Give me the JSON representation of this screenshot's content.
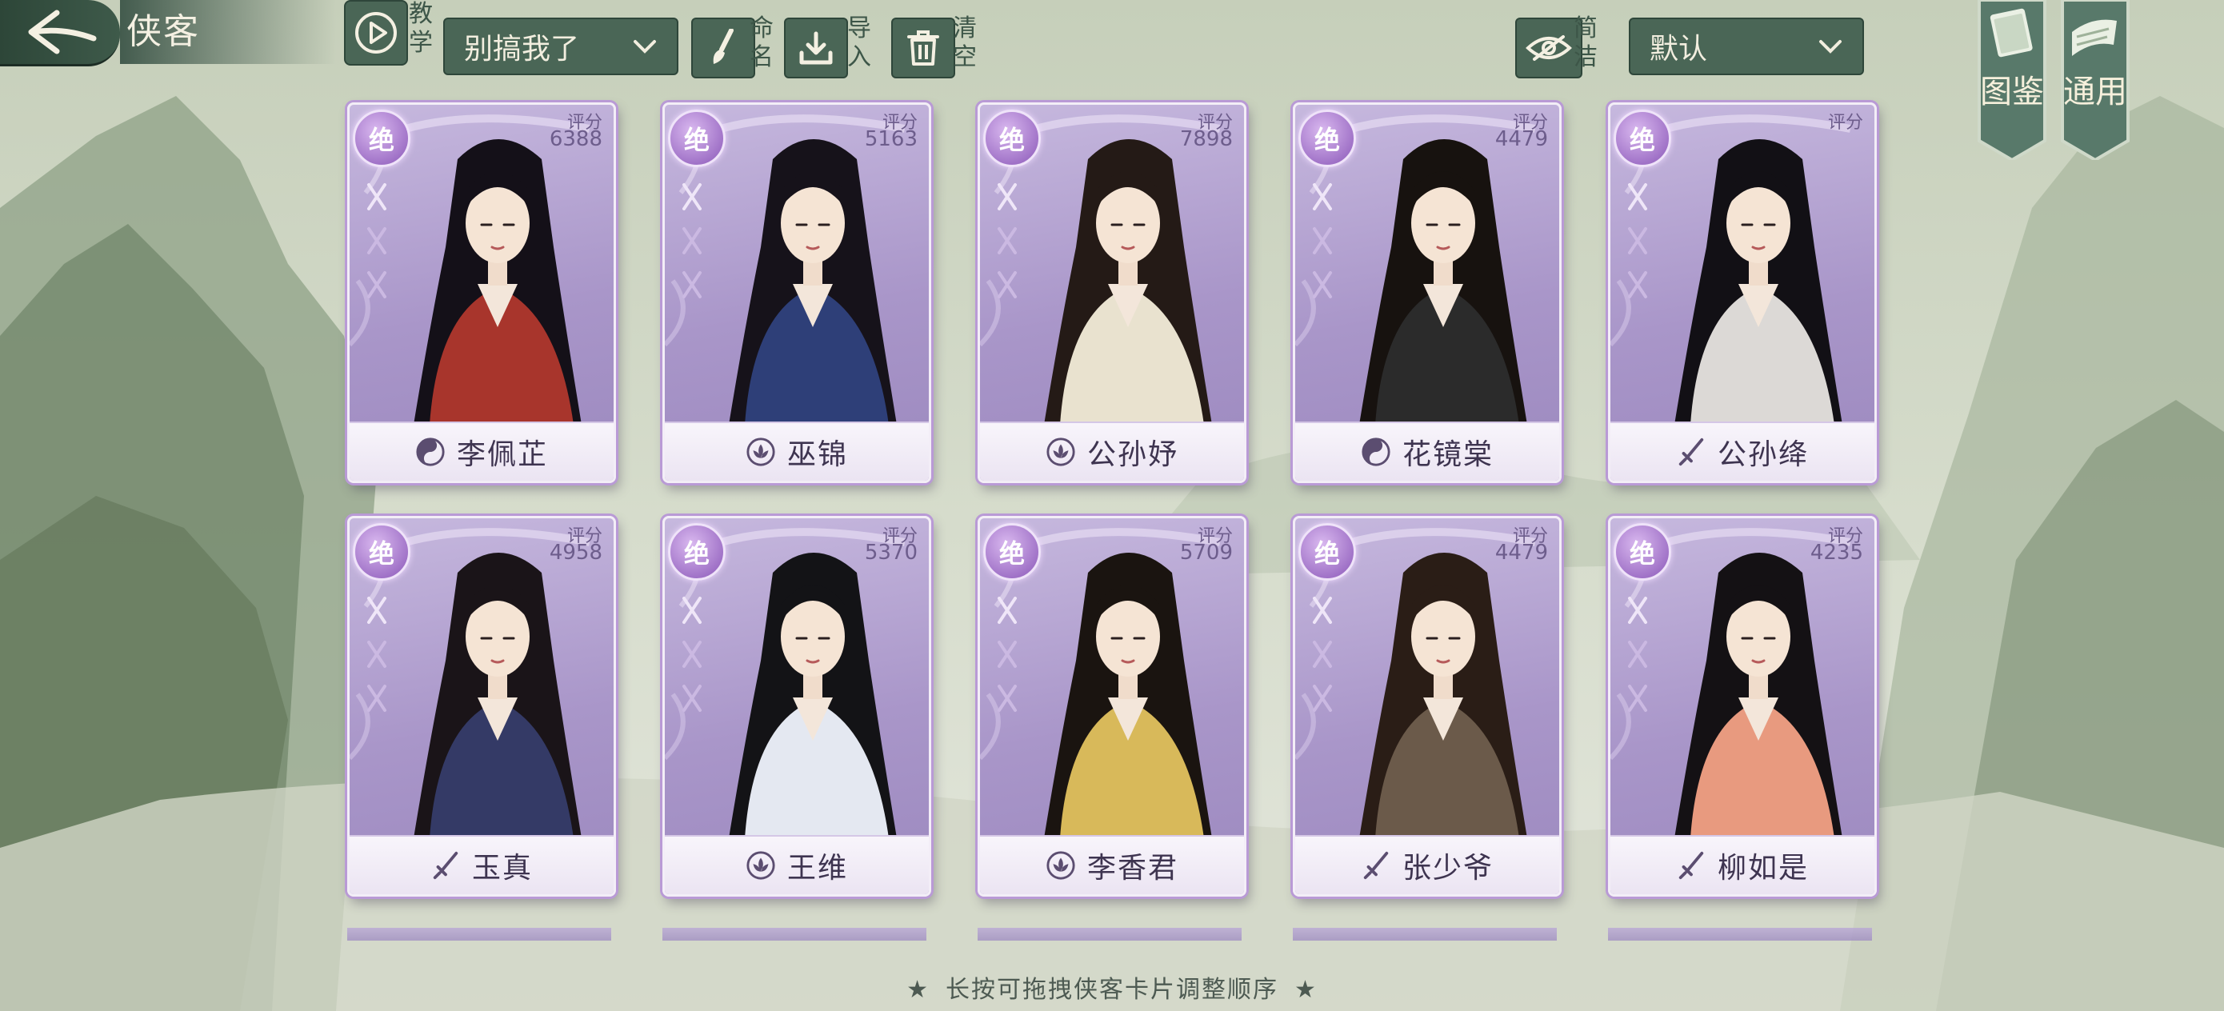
{
  "header": {
    "title": "侠客",
    "tutorial_label": "教学",
    "team_select": "别搞我了",
    "rename_label": "命名",
    "import_label": "导入",
    "clear_label": "清空",
    "simple_label": "简洁",
    "sort_select": "默认"
  },
  "side_banners": {
    "codex": "图鉴",
    "general": "通用"
  },
  "score_caption": "评分",
  "cards": [
    {
      "name": "李佩芷",
      "score": "6388",
      "grade": "绝",
      "school": "taiji-icon"
    },
    {
      "name": "巫锦",
      "score": "5163",
      "grade": "绝",
      "school": "lotus-icon"
    },
    {
      "name": "公孙妤",
      "score": "7898",
      "grade": "绝",
      "school": "lotus-icon"
    },
    {
      "name": "花镜棠",
      "score": "4479",
      "grade": "绝",
      "school": "taiji-icon"
    },
    {
      "name": "公孙绛",
      "score": "",
      "grade": "绝",
      "school": "sword-icon"
    },
    {
      "name": "玉真",
      "score": "4958",
      "grade": "绝",
      "school": "sword-icon"
    },
    {
      "name": "王维",
      "score": "5370",
      "grade": "绝",
      "school": "lotus-icon"
    },
    {
      "name": "李香君",
      "score": "5709",
      "grade": "绝",
      "school": "lotus-icon"
    },
    {
      "name": "张少爷",
      "score": "4479",
      "grade": "绝",
      "school": "sword-icon"
    },
    {
      "name": "柳如是",
      "score": "4235",
      "grade": "绝",
      "school": "sword-icon"
    }
  ],
  "hint": "长按可拖拽侠客卡片调整顺序",
  "colors": {
    "accent_green": "#4a6656",
    "card_purple": "#a996c9",
    "name_plate": "#f8f5fb"
  }
}
